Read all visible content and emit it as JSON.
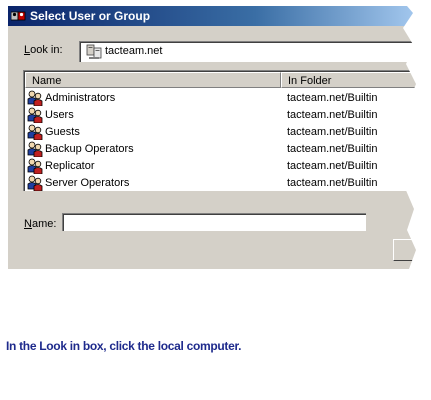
{
  "window": {
    "title": "Select User or Group",
    "title_bar_colors": [
      "#0a246a",
      "#a6caf0"
    ]
  },
  "look_in": {
    "label_accel": "L",
    "label_rest": "ook in:",
    "value": "tacteam.net",
    "icon": "domain-computer-icon"
  },
  "list": {
    "columns": [
      "Name",
      "In Folder"
    ],
    "rows": [
      {
        "name": "Administrators",
        "folder": "tacteam.net/Builtin",
        "icon": "group-icon"
      },
      {
        "name": "Users",
        "folder": "tacteam.net/Builtin",
        "icon": "group-icon"
      },
      {
        "name": "Guests",
        "folder": "tacteam.net/Builtin",
        "icon": "group-icon"
      },
      {
        "name": "Backup Operators",
        "folder": "tacteam.net/Builtin",
        "icon": "group-icon"
      },
      {
        "name": "Replicator",
        "folder": "tacteam.net/Builtin",
        "icon": "group-icon"
      },
      {
        "name": "Server Operators",
        "folder": "tacteam.net/Builtin",
        "icon": "group-icon"
      }
    ]
  },
  "name_field": {
    "label_accel": "N",
    "label_rest": "ame:",
    "value": ""
  },
  "instruction": "In the Look in box, click the local computer.",
  "colors": {
    "dialog_face": "#d4d0c8",
    "caption_text": "#1e2a8c"
  }
}
